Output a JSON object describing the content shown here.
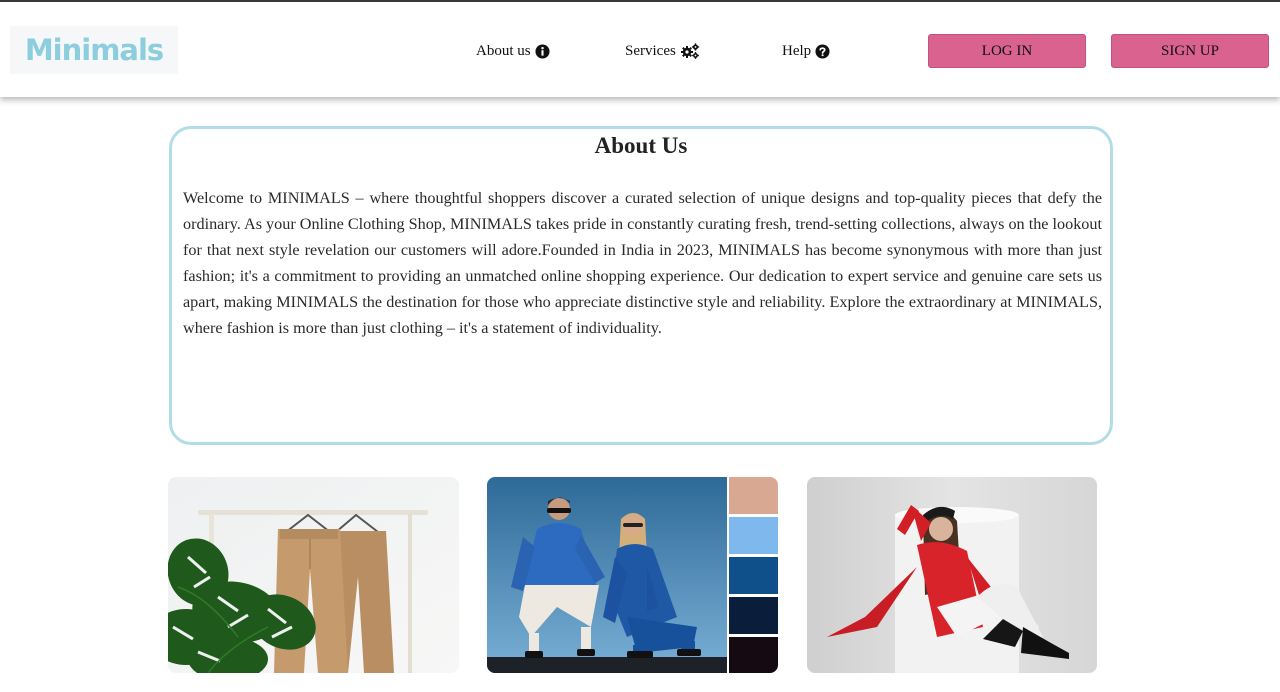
{
  "header": {
    "logo_text": "Minimals",
    "nav": {
      "about_label": "About us",
      "services_label": "Services",
      "help_label": "Help"
    },
    "login_label": "LOG IN",
    "signup_label": "SIGN UP"
  },
  "about": {
    "title": "About Us",
    "body": "Welcome to MINIMALS – where thoughtful shoppers discover a curated selection of unique designs and top-quality pieces that defy the ordinary. As your Online Clothing Shop, MINIMALS takes pride in constantly curating fresh, trend-setting collections, always on the lookout for that next style revelation our customers will adore.Founded in India in 2023, MINIMALS has become synonymous with more than just fashion; it's a commitment to providing an unmatched online shopping experience. Our dedication to expert service and genuine care sets us apart, making MINIMALS the destination for those who appreciate distinctive style and reliability. Explore the extraordinary at MINIMALS, where fashion is more than just clothing – it's a statement of individuality."
  },
  "gallery": [
    {
      "subject": "trousers-on-rack-with-monstera-plant"
    },
    {
      "subject": "couple-in-blue-outfits-with-color-palette",
      "palette": [
        "#d9a892",
        "#7fb8ec",
        "#0f4f8a",
        "#0a1e3c",
        "#150a12"
      ]
    },
    {
      "subject": "woman-in-red-coat-sitting"
    }
  ],
  "colors": {
    "accent": "#d9628e",
    "logo": "#8ccedd",
    "box_border": "#b3dde6"
  },
  "icons": {
    "about": "info-circle-icon",
    "services": "gears-icon",
    "help": "question-circle-icon"
  }
}
